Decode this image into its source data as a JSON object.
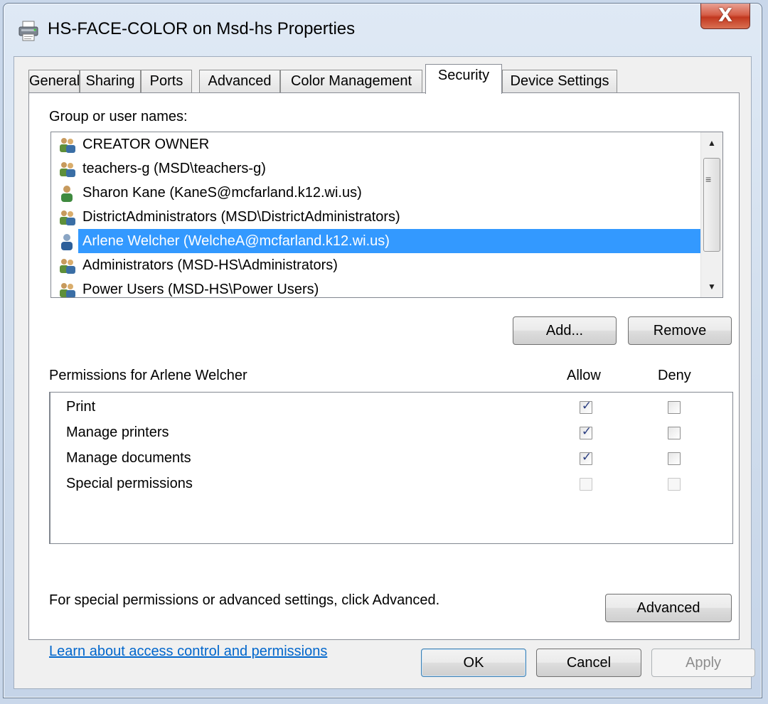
{
  "window": {
    "title": "HS-FACE-COLOR on Msd-hs Properties",
    "close_glyph": "X"
  },
  "tabs": [
    {
      "label": "General"
    },
    {
      "label": "Sharing"
    },
    {
      "label": "Ports"
    },
    {
      "label": "Advanced"
    },
    {
      "label": "Color Management"
    },
    {
      "label": "Security",
      "active": true
    },
    {
      "label": "Device Settings"
    }
  ],
  "security": {
    "group_label": "Group or user names:",
    "users": [
      {
        "name": "CREATOR OWNER",
        "icon": "group-icon"
      },
      {
        "name": "teachers-g (MSD\\teachers-g)",
        "icon": "group-icon"
      },
      {
        "name": "Sharon Kane (KaneS@mcfarland.k12.wi.us)",
        "icon": "user-icon"
      },
      {
        "name": "DistrictAdministrators (MSD\\DistrictAdministrators)",
        "icon": "group-icon"
      },
      {
        "name": "Arlene Welcher (WelcheA@mcfarland.k12.wi.us)",
        "icon": "user-icon",
        "selected": true
      },
      {
        "name": "Administrators (MSD-HS\\Administrators)",
        "icon": "group-icon"
      },
      {
        "name": "Power Users (MSD-HS\\Power Users)",
        "icon": "group-icon"
      }
    ],
    "add_button": "Add...",
    "remove_button": "Remove",
    "permissions_label": "Permissions for Arlene Welcher",
    "allow_header": "Allow",
    "deny_header": "Deny",
    "permissions": [
      {
        "name": "Print",
        "allow": true,
        "deny": false,
        "enabled": true
      },
      {
        "name": "Manage printers",
        "allow": true,
        "deny": false,
        "enabled": true
      },
      {
        "name": "Manage documents",
        "allow": true,
        "deny": false,
        "enabled": true
      },
      {
        "name": "Special permissions",
        "allow": false,
        "deny": false,
        "enabled": false
      }
    ],
    "advanced_hint": "For special permissions or advanced settings, click Advanced.",
    "advanced_button": "Advanced",
    "learn_link": "Learn about access control and permissions"
  },
  "footer": {
    "ok": "OK",
    "cancel": "Cancel",
    "apply": "Apply"
  },
  "colors": {
    "selection": "#3399ff",
    "link": "#0066cc",
    "close_button": "#c2381f"
  }
}
